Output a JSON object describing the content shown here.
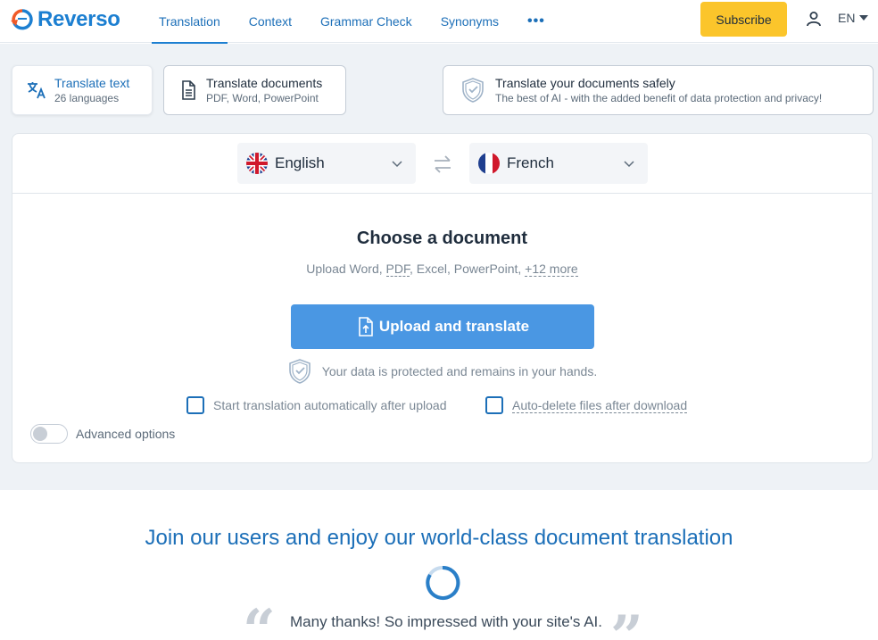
{
  "header": {
    "logo_text": "Reverso",
    "nav": [
      {
        "label": "Translation",
        "active": true
      },
      {
        "label": "Context",
        "active": false
      },
      {
        "label": "Grammar Check",
        "active": false
      },
      {
        "label": "Synonyms",
        "active": false
      }
    ],
    "more_label": "•••",
    "subscribe_label": "Subscribe",
    "language_code": "EN"
  },
  "modes": {
    "translate_text": {
      "title": "Translate text",
      "subtitle": "26 languages"
    },
    "translate_documents": {
      "title": "Translate documents",
      "subtitle": "PDF, Word, PowerPoint"
    },
    "safe": {
      "title": "Translate your documents safely",
      "subtitle": "The best of AI - with the added benefit of data protection and privacy!"
    }
  },
  "translator": {
    "source_language": "English",
    "target_language": "French",
    "choose_title": "Choose a document",
    "formats_prefix": "Upload Word, ",
    "formats_pdf": "PDF",
    "formats_middle": ", Excel, PowerPoint, ",
    "formats_more": "+12 more",
    "upload_label": "Upload and translate",
    "protect_text": "Your data is protected and remains in your hands.",
    "auto_start_label": "Start translation automatically after upload",
    "auto_delete_label": "Auto-delete files after download",
    "advanced_label": "Advanced options"
  },
  "lower": {
    "join_heading": "Join our users and enjoy our world-class document translation",
    "testimonial": "Many thanks! So impressed with your site's AI."
  },
  "colors": {
    "brand_blue": "#1c7fd1",
    "subscribe_yellow": "#fbc52b",
    "upload_blue": "#4a97e3",
    "logo_orange": "#f05a28"
  }
}
